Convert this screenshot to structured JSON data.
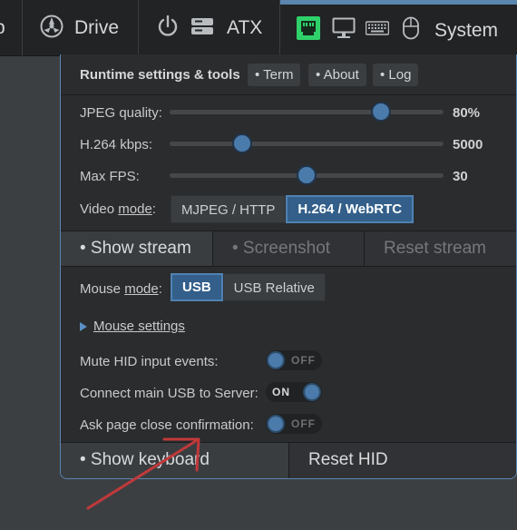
{
  "navbar": {
    "partial_label": "p",
    "drive_label": "Drive",
    "atx_label": "ATX",
    "system_label": "System",
    "icons": [
      "drive-icon",
      "power-icon",
      "atx-device-icon",
      "network-status-icon",
      "monitor-icon",
      "keyboard-icon",
      "mouse-icon"
    ],
    "accent_color": "#5b86b0",
    "network_led_color": "#2fd26a"
  },
  "header": {
    "title": "Runtime settings & tools",
    "buttons": [
      "• Term",
      "• About",
      "• Log"
    ]
  },
  "sliders": [
    {
      "label": "JPEG quality:",
      "value_text": "80%",
      "position": 0.77
    },
    {
      "label": "H.264 kbps:",
      "value_text": "5000",
      "position": 0.265
    },
    {
      "label": "Max FPS:",
      "value_text": "30",
      "position": 0.5
    }
  ],
  "video_mode": {
    "label_prefix": "Video ",
    "label_link": "mode",
    "label_suffix": ":",
    "options": [
      "MJPEG / HTTP",
      "H.264 / WebRTC"
    ],
    "selected": "H.264 / WebRTC"
  },
  "stream": {
    "show": "• Show stream",
    "screenshot": "• Screenshot",
    "reset": "Reset stream"
  },
  "mouse_mode": {
    "label_prefix": "Mouse ",
    "label_link": "mode",
    "label_suffix": ":",
    "options": [
      "USB",
      "USB Relative"
    ],
    "selected": "USB"
  },
  "mouse_settings": "Mouse settings",
  "toggles": [
    {
      "label": "Mute HID input events:",
      "state": "OFF"
    },
    {
      "label": "Connect main USB to Server:",
      "state": "ON"
    },
    {
      "label": "Ask page close confirmation:",
      "state": "OFF"
    }
  ],
  "bottom": {
    "keyboard": "• Show keyboard",
    "reset_hid": "Reset HID"
  },
  "annotation_arrow_color": "#c0393b"
}
